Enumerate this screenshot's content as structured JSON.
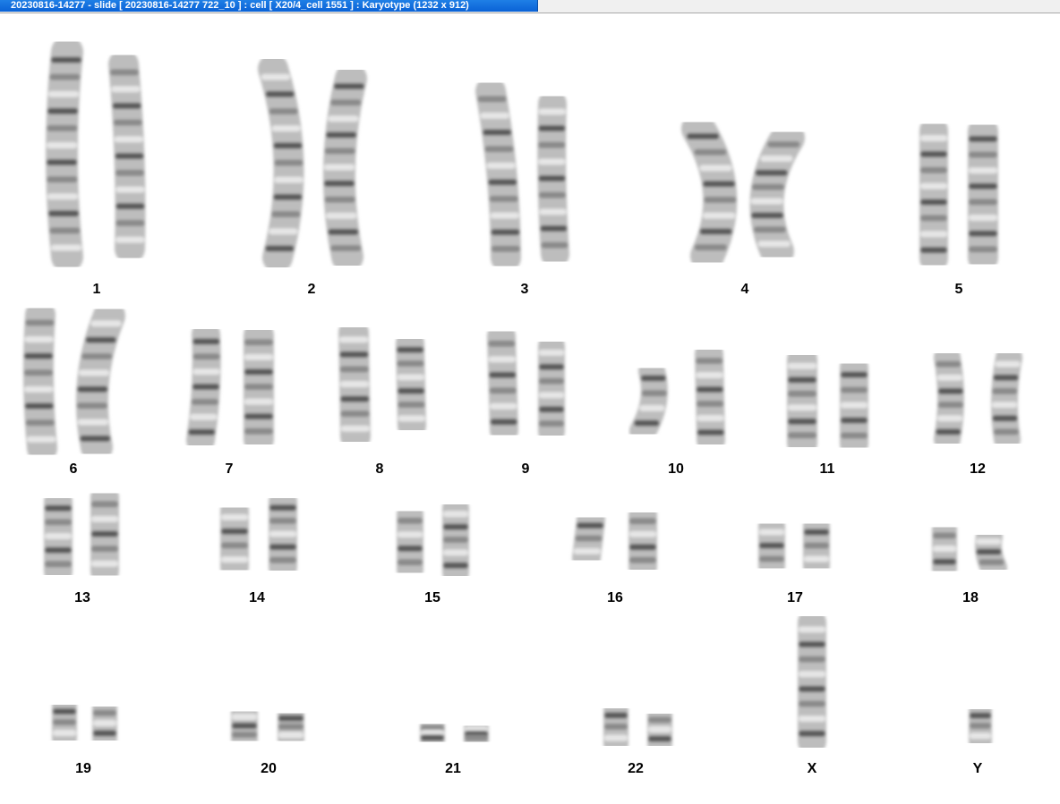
{
  "window": {
    "title": "20230816-14277 - slide [ 20230816-14277 722_10 ] : cell [ X20/4_cell 1551 ] : Karyotype  (1232 x 912)"
  },
  "karyotype": {
    "labels": {
      "c1": "1",
      "c2": "2",
      "c3": "3",
      "c4": "4",
      "c5": "5",
      "c6": "6",
      "c7": "7",
      "c8": "8",
      "c9": "9",
      "c10": "10",
      "c11": "11",
      "c12": "12",
      "c13": "13",
      "c14": "14",
      "c15": "15",
      "c16": "16",
      "c17": "17",
      "c18": "18",
      "c19": "19",
      "c20": "20",
      "c21": "21",
      "c22": "22",
      "cx": "X",
      "cy": "Y"
    }
  },
  "colors": {
    "titlebar": "#0a62d6",
    "chromosome_light": "#d8d8d8",
    "chromosome_dark": "#3a3a3a",
    "label": "#000000"
  }
}
